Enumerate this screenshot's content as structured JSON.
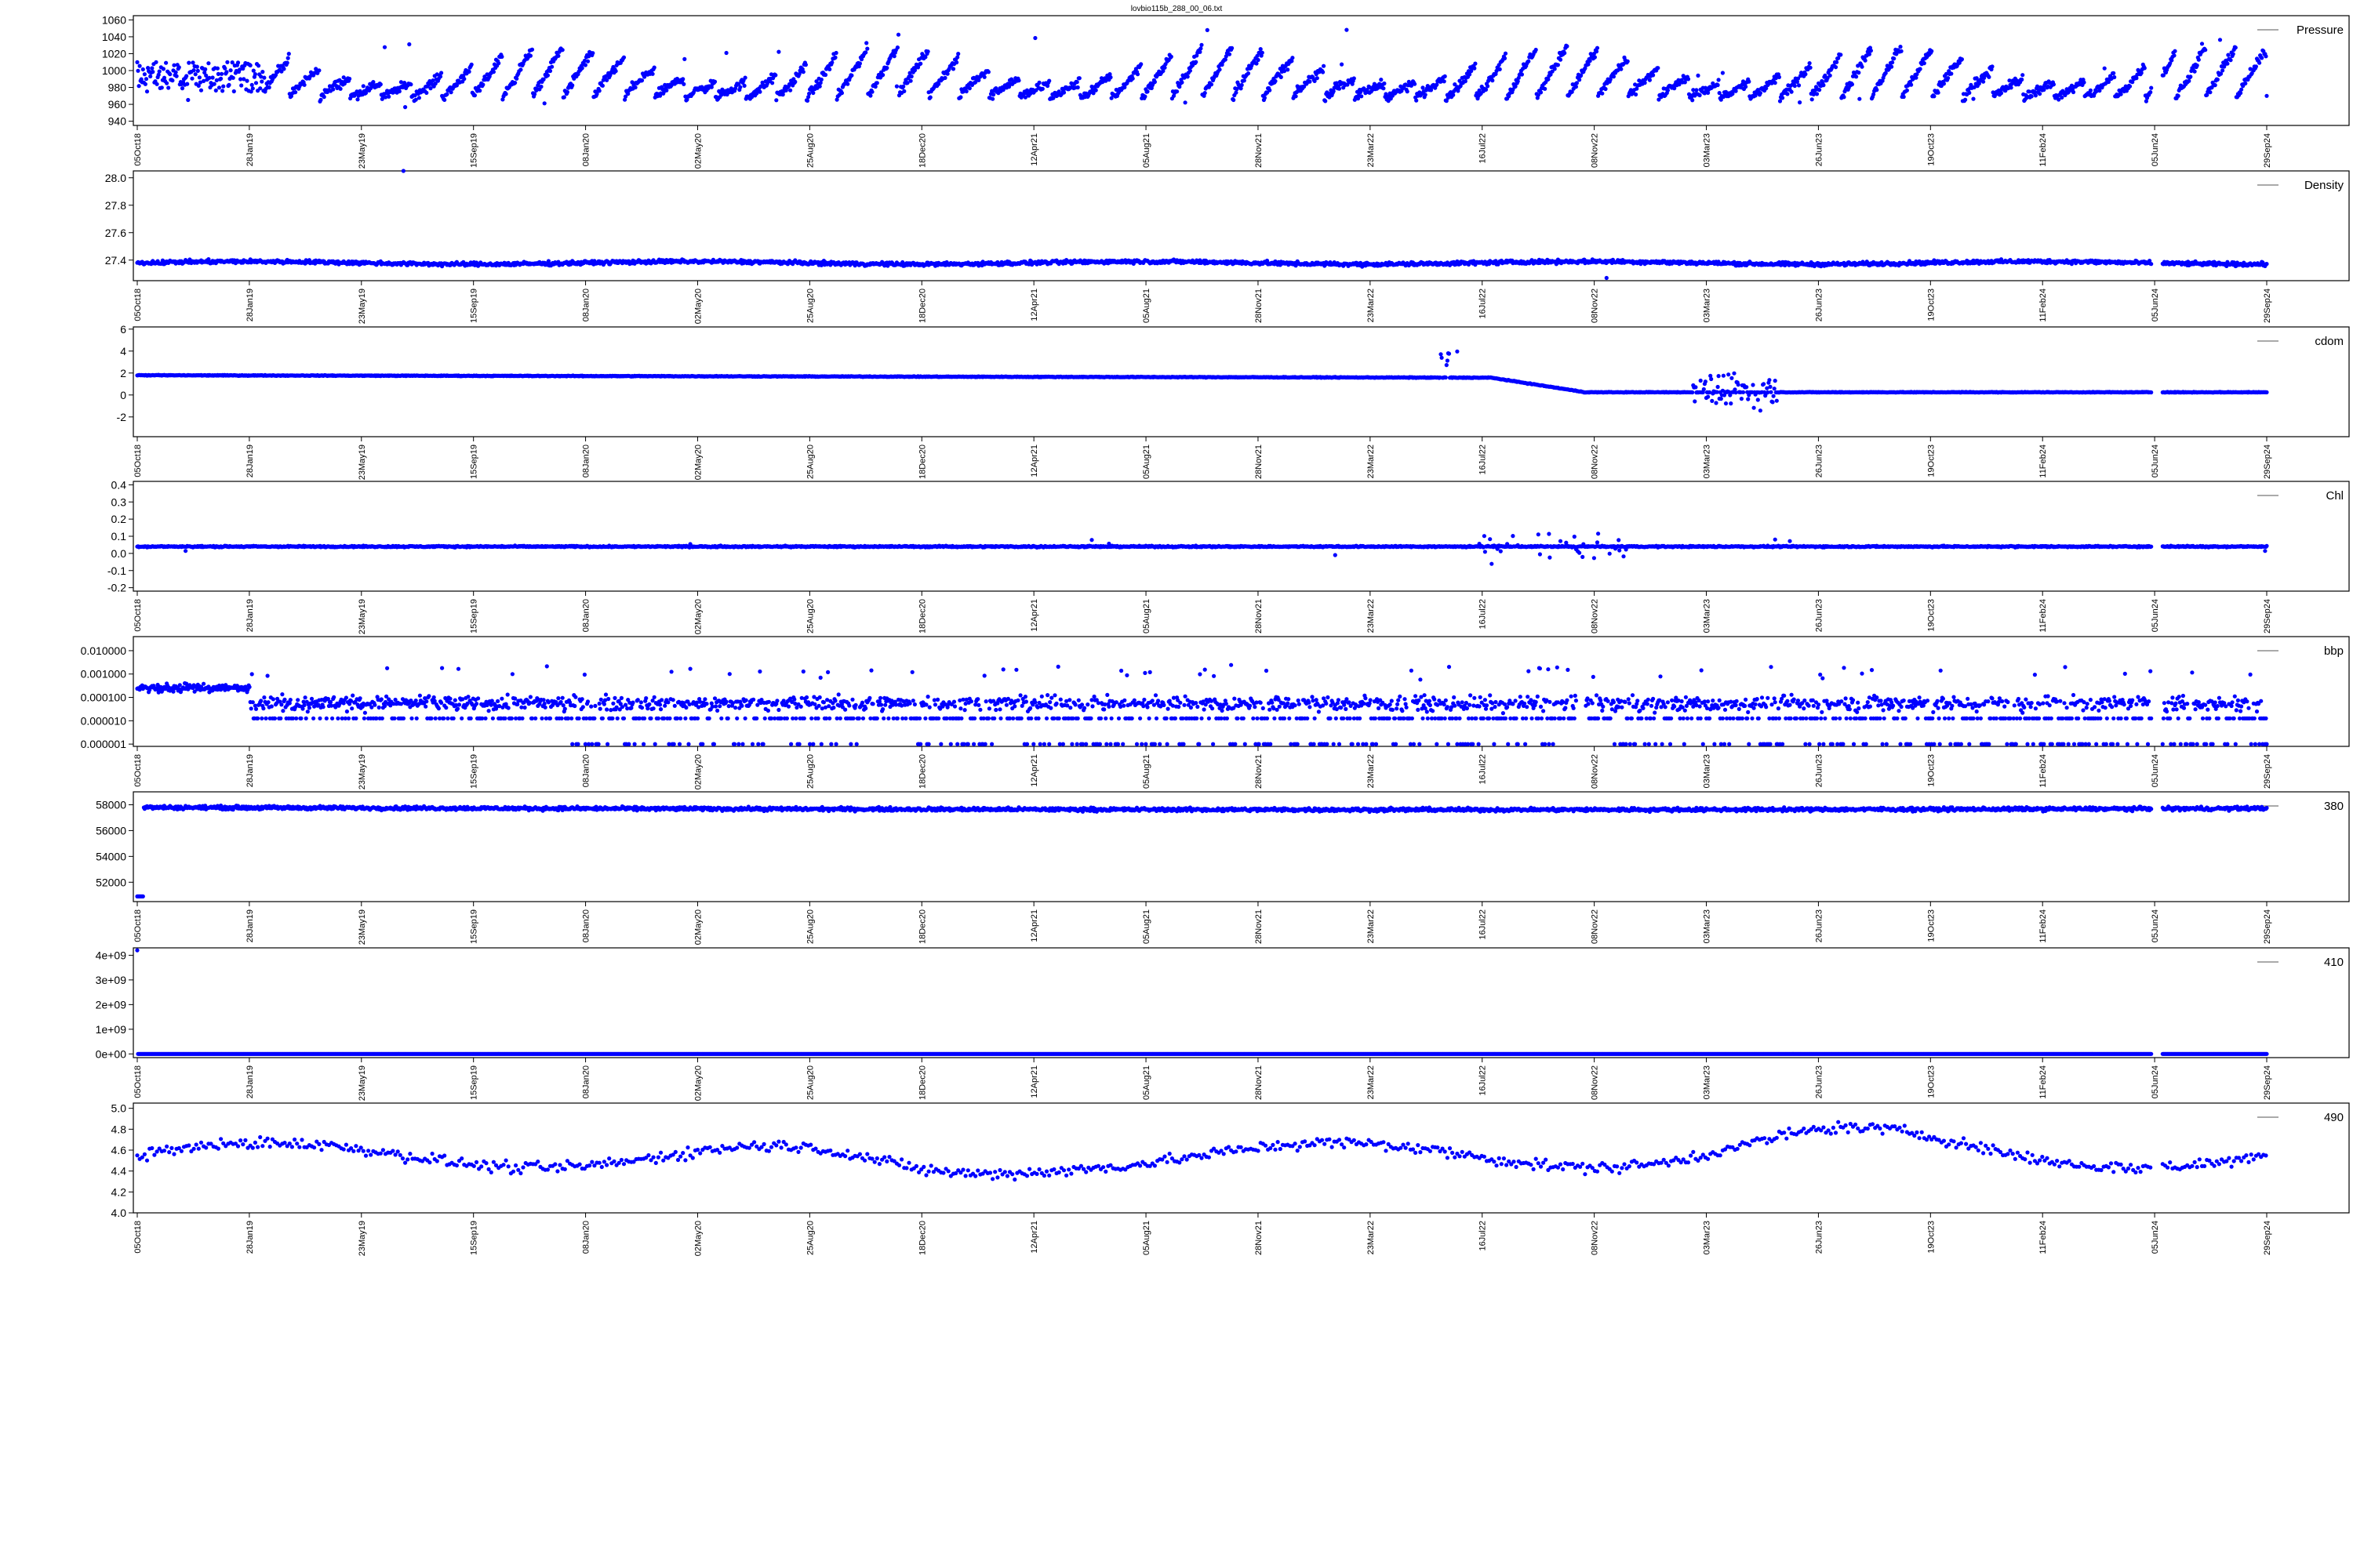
{
  "title": "lovbio115b_288_00_06.txt",
  "colors": {
    "series": "#0000ff",
    "axis": "#000000"
  },
  "x_ticks": [
    "05Oct18",
    "28Jan19",
    "23May19",
    "15Sep19",
    "08Jan20",
    "02May20",
    "25Aug20",
    "18Dec20",
    "12Apr21",
    "05Aug21",
    "28Nov21",
    "23Mar22",
    "16Jul22",
    "08Nov22",
    "03Mar23",
    "26Jun23",
    "19Oct23",
    "11Feb24",
    "05Jun24",
    "29Sep24"
  ],
  "chart_data": [
    {
      "type": "scatter",
      "legend": "Pressure",
      "ylim": [
        935,
        1065
      ],
      "yscale": "linear",
      "yticks": [
        "940",
        "960",
        "980",
        "1000",
        "1020",
        "1040",
        "1060"
      ],
      "ytick_values": [
        940,
        960,
        980,
        1000,
        1020,
        1040,
        1060
      ],
      "pattern": "sawtooth",
      "base": 980,
      "amp": 50,
      "noise": 8,
      "legend_position": "top-right"
    },
    {
      "type": "scatter",
      "legend": "Density",
      "ylim": [
        27.25,
        28.05
      ],
      "yscale": "linear",
      "yticks": [
        "27.4",
        "27.6",
        "27.8",
        "28.0"
      ],
      "ytick_values": [
        27.4,
        27.6,
        27.8,
        28.0
      ],
      "pattern": "flat",
      "base": 27.38,
      "noise": 0.02,
      "outliers": [
        {
          "x": 0.125,
          "y": 28.05
        },
        {
          "x": 0.69,
          "y": 27.27
        }
      ],
      "legend_position": "top-right"
    },
    {
      "type": "scatter",
      "legend": "cdom",
      "ylim": [
        -3.8,
        6.2
      ],
      "yscale": "linear",
      "yticks": [
        "-2",
        "0",
        "2",
        "4",
        "6"
      ],
      "ytick_values": [
        -2,
        0,
        2,
        4,
        6
      ],
      "pattern": "cdom",
      "base": 1.8,
      "noise": 0.05,
      "legend_position": "top-right"
    },
    {
      "type": "scatter",
      "legend": "Chl",
      "ylim": [
        -0.22,
        0.42
      ],
      "yscale": "linear",
      "yticks": [
        "-0.2",
        "-0.1",
        "0.0",
        "0.1",
        "0.2",
        "0.3",
        "0.4"
      ],
      "ytick_values": [
        -0.2,
        -0.1,
        0.0,
        0.1,
        0.2,
        0.3,
        0.4
      ],
      "pattern": "chl",
      "base": 0.04,
      "noise": 0.006,
      "legend_position": "top-right"
    },
    {
      "type": "scatter",
      "legend": "bbp",
      "ylim": [
        8e-07,
        0.04
      ],
      "yscale": "log",
      "yticks": [
        "0.000001",
        "0.000010",
        "0.000100",
        "0.001000",
        "0.010000"
      ],
      "ytick_values": [
        1e-06,
        1e-05,
        0.0001,
        0.001,
        0.01
      ],
      "pattern": "bbp",
      "legend_position": "top-right"
    },
    {
      "type": "scatter",
      "legend": "380",
      "ylim": [
        50500,
        59000
      ],
      "yscale": "linear",
      "yticks": [
        "52000",
        "54000",
        "56000",
        "58000"
      ],
      "ytick_values": [
        52000,
        54000,
        56000,
        58000
      ],
      "pattern": "p380",
      "base": 57800,
      "noise": 200,
      "legend_position": "top-right"
    },
    {
      "type": "scatter",
      "legend": "410",
      "ylim": [
        -150000000.0,
        4300000000.0
      ],
      "yscale": "linear",
      "yticks": [
        "0e+00",
        "1e+09",
        "2e+09",
        "3e+09",
        "4e+09"
      ],
      "ytick_values": [
        0,
        1000000000.0,
        2000000000.0,
        3000000000.0,
        4000000000.0
      ],
      "pattern": "p410",
      "legend_position": "top-right"
    },
    {
      "type": "scatter",
      "legend": "490",
      "ylim": [
        4.0,
        5.05
      ],
      "yscale": "linear",
      "yticks": [
        "4.0",
        "4.2",
        "4.4",
        "4.6",
        "4.8",
        "5.0"
      ],
      "ytick_values": [
        4.0,
        4.2,
        4.4,
        4.6,
        4.8,
        5.0
      ],
      "pattern": "p490",
      "base": 4.55,
      "noise": 0.08,
      "legend_position": "top-right"
    }
  ]
}
